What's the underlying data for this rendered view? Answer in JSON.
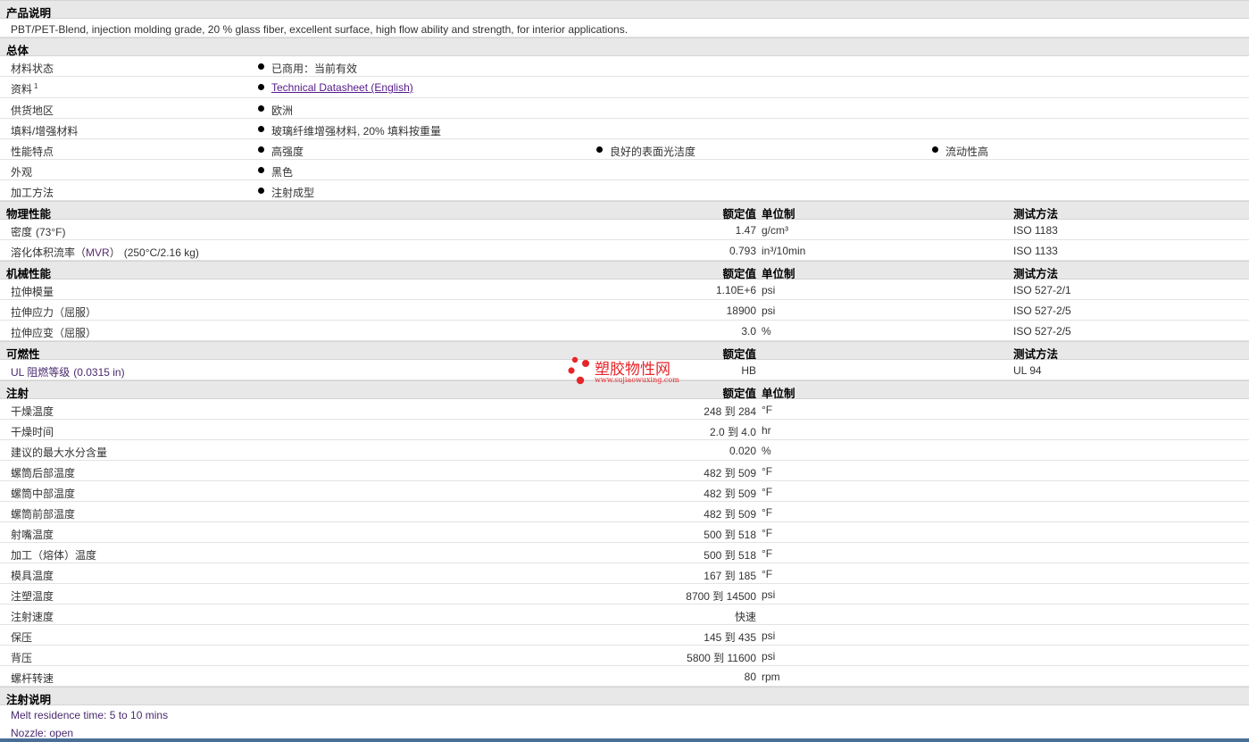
{
  "sections": {
    "desc": {
      "title": "产品说明",
      "text": "PBT/PET-Blend, injection molding grade, 20 % glass fiber, excellent surface, high flow ability and strength, for interior applications."
    },
    "general": {
      "title": "总体",
      "rows": {
        "status": {
          "label": "材料状态",
          "value": "已商用：当前有效"
        },
        "docs": {
          "label": "资料",
          "sup": "1",
          "value": "Technical Datasheet (English)"
        },
        "region": {
          "label": "供货地区",
          "value": "欧洲"
        },
        "filler": {
          "label": "填料/增强材料",
          "value": "玻璃纤维增强材料, 20% 填料按重量"
        },
        "features": {
          "label": "性能特点",
          "value1": "高强度",
          "value2": "良好的表面光洁度",
          "value3": "流动性高"
        },
        "appearance": {
          "label": "外观",
          "value": "黑色"
        },
        "processing": {
          "label": "加工方法",
          "value": "注射成型"
        }
      }
    },
    "physical": {
      "title": "物理性能",
      "h_val": "额定值",
      "h_unit": "单位制",
      "h_test": "测试方法",
      "rows": {
        "density": {
          "label": "密度",
          "cond": "(73°F)",
          "value": "1.47",
          "unit": "g/cm³",
          "test": "ISO 1183"
        },
        "mvr": {
          "label_a": "溶化体积流率（",
          "label_mvr": "MVR",
          "label_b": "）",
          "cond": "(250°C/2.16 kg)",
          "value": "0.793",
          "unit": "in³/10min",
          "test": "ISO 1133"
        }
      }
    },
    "mechanical": {
      "title": "机械性能",
      "h_val": "额定值",
      "h_unit": "单位制",
      "h_test": "测试方法",
      "rows": {
        "modulus": {
          "label": "拉伸模量",
          "value": "1.10E+6",
          "unit": "psi",
          "test": "ISO 527-2/1"
        },
        "stress": {
          "label": "拉伸应力（屈服）",
          "value": "18900",
          "unit": "psi",
          "test": "ISO 527-2/5"
        },
        "strain": {
          "label": "拉伸应变（屈服）",
          "value": "3.0",
          "unit": "%",
          "test": "ISO 527-2/5"
        }
      }
    },
    "flammability": {
      "title": "可燃性",
      "h_val": "额定值",
      "h_test": "测试方法",
      "rows": {
        "ul": {
          "label": "UL 阻燃等级",
          "cond": "(0.0315 in)",
          "value": "HB",
          "test": "UL 94"
        }
      }
    },
    "injection": {
      "title": "注射",
      "h_val": "额定值",
      "h_unit": "单位制",
      "rows": [
        {
          "label": "干燥温度",
          "value": "248 到  284",
          "unit": "°F"
        },
        {
          "label": "干燥时间",
          "value": "2.0 到  4.0",
          "unit": "hr"
        },
        {
          "label": "建议的最大水分含量",
          "value": "0.020",
          "unit": "%"
        },
        {
          "label": "螺筒后部温度",
          "value": "482 到  509",
          "unit": "°F"
        },
        {
          "label": "螺筒中部温度",
          "value": "482 到  509",
          "unit": "°F"
        },
        {
          "label": "螺筒前部温度",
          "value": "482 到  509",
          "unit": "°F"
        },
        {
          "label": "射嘴温度",
          "value": "500 到  518",
          "unit": "°F"
        },
        {
          "label": "加工（熔体）温度",
          "value": "500 到  518",
          "unit": "°F"
        },
        {
          "label": "模具温度",
          "value": "167 到  185",
          "unit": "°F"
        },
        {
          "label": "注塑温度",
          "value": "8700 到  14500",
          "unit": "psi"
        },
        {
          "label": "注射速度",
          "value": "快速",
          "unit": ""
        },
        {
          "label": "保压",
          "value": "145 到  435",
          "unit": "psi"
        },
        {
          "label": "背压",
          "value": "5800 到  11600",
          "unit": "psi"
        },
        {
          "label": "螺杆转速",
          "value": "80",
          "unit": "rpm"
        }
      ]
    },
    "inj_notes": {
      "title": "注射说明",
      "lines": [
        "Melt residence time: 5 to 10 mins",
        "Nozzle: open"
      ]
    }
  },
  "watermark": {
    "name": "塑胶物性网",
    "url": "www.sujiaowuxing.com",
    "color": "#e5262b"
  }
}
